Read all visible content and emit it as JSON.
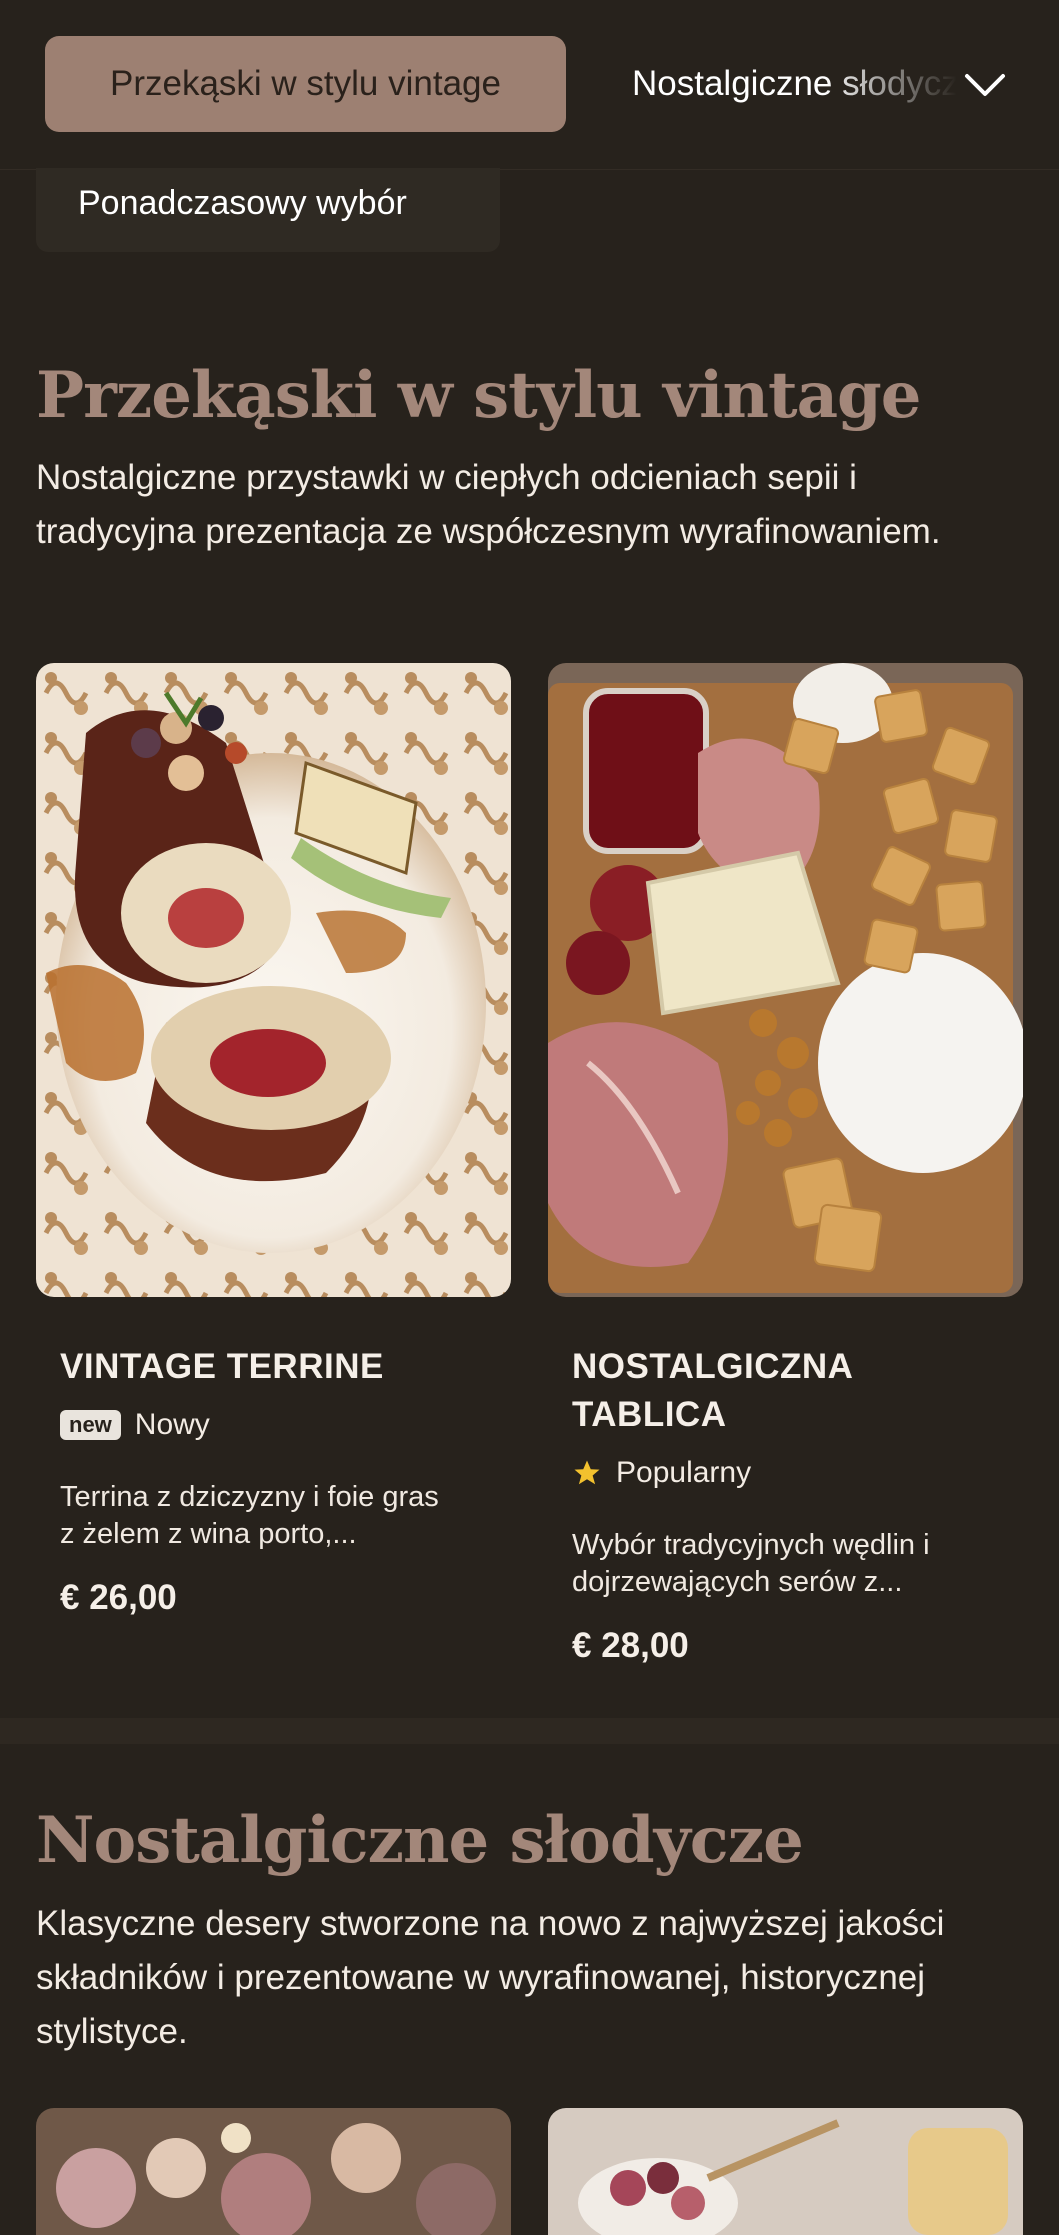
{
  "nav": {
    "active_category": "Przekąski w stylu vintage",
    "next_category": "Nostalgiczne słodycze",
    "extra_category": "Ponadczasowy wybór",
    "expand_icon": "chevron-down-icon"
  },
  "sections": [
    {
      "title": "Przekąski w stylu vintage",
      "description": "Nostalgiczne przystawki w ciepłych odcieniach sepii i tradycyjna prezentacja ze współczesnym wyrafinowaniem.",
      "items": [
        {
          "name": "VINTAGE TERRINE",
          "badge_tag": "new",
          "badge_label": "Nowy",
          "description_line1": "Terrina z dziczyzny i foie gras",
          "description_line2": "z żelem z wina porto,...",
          "price": "€ 26,00"
        },
        {
          "name_line1": "NOSTALGICZNA",
          "name_line2": "TABLICA",
          "badge_icon": "star-icon",
          "badge_label": "Popularny",
          "description_line1": "Wybór tradycyjnych wędlin i",
          "description_line2": "dojrzewających serów z...",
          "price": "€ 28,00"
        }
      ]
    },
    {
      "title": "Nostalgiczne słodycze",
      "description": "Klasyczne desery stworzone na nowo z najwyższej jakości składników i prezentowane w wyrafinowanej, historycznej stylistyce."
    }
  ],
  "colors": {
    "background": "#27221c",
    "accent": "#9d8072",
    "heading": "#a3877a",
    "star": "#f2c12e"
  }
}
